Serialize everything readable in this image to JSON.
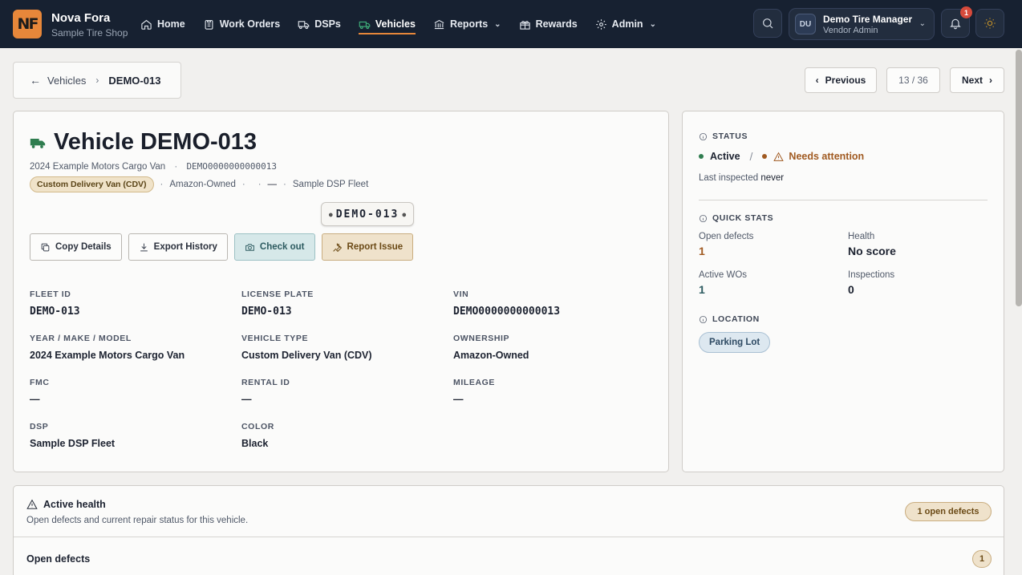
{
  "app": {
    "name": "Nova Fora",
    "shop": "Sample Tire Shop",
    "logo_text": "NF"
  },
  "nav": {
    "items": [
      {
        "label": "Home",
        "icon": "home-icon"
      },
      {
        "label": "Work Orders",
        "icon": "clipboard-icon"
      },
      {
        "label": "DSPs",
        "icon": "truck-icon"
      },
      {
        "label": "Vehicles",
        "icon": "van-icon",
        "active": true
      },
      {
        "label": "Reports",
        "icon": "bank-icon",
        "dropdown": true
      },
      {
        "label": "Rewards",
        "icon": "gift-icon"
      },
      {
        "label": "Admin",
        "icon": "gear-icon",
        "dropdown": true
      }
    ]
  },
  "user": {
    "initials": "DU",
    "name": "Demo Tire Manager",
    "role": "Vendor Admin",
    "notifications": "1"
  },
  "breadcrumb": {
    "parent": "Vehicles",
    "current": "DEMO-013"
  },
  "pager": {
    "previous": "Previous",
    "count": "13 / 36",
    "next": "Next"
  },
  "vehicle": {
    "title": "Vehicle DEMO-013",
    "model_line": "2024 Example Motors Cargo Van",
    "vin_line": "DEMO0000000000013",
    "type_pill": "Custom Delivery Van (CDV)",
    "ownership_tag": "Amazon-Owned",
    "dash": "—",
    "fleet_tag": "Sample DSP Fleet",
    "plate": "DEMO-013"
  },
  "actions": {
    "copy": "Copy Details",
    "export": "Export History",
    "checkout": "Check out",
    "report": "Report Issue"
  },
  "fields": [
    {
      "label": "FLEET ID",
      "value": "DEMO-013",
      "mono": true
    },
    {
      "label": "LICENSE PLATE",
      "value": "DEMO-013",
      "mono": true
    },
    {
      "label": "VIN",
      "value": "DEMO0000000000013",
      "mono": true
    },
    {
      "label": "YEAR / MAKE / MODEL",
      "value": "2024 Example Motors Cargo Van"
    },
    {
      "label": "VEHICLE TYPE",
      "value": "Custom Delivery Van (CDV)"
    },
    {
      "label": "OWNERSHIP",
      "value": "Amazon-Owned"
    },
    {
      "label": "FMC",
      "value": "—"
    },
    {
      "label": "RENTAL ID",
      "value": "—"
    },
    {
      "label": "MILEAGE",
      "value": "—"
    },
    {
      "label": "DSP",
      "value": "Sample DSP Fleet"
    },
    {
      "label": "COLOR",
      "value": "Black"
    }
  ],
  "status": {
    "label": "STATUS",
    "active": "Active",
    "attention": "Needs attention",
    "last_inspected_prefix": "Last inspected",
    "last_inspected_value": "never"
  },
  "quick_stats": {
    "label": "QUICK STATS",
    "open_defects_label": "Open defects",
    "open_defects_value": "1",
    "health_label": "Health",
    "health_value": "No score",
    "active_wos_label": "Active WOs",
    "active_wos_value": "1",
    "inspections_label": "Inspections",
    "inspections_value": "0"
  },
  "location": {
    "label": "LOCATION",
    "value": "Parking Lot"
  },
  "health": {
    "title": "Active health",
    "subtitle": "Open defects and current repair status for this vehicle.",
    "badge": "1 open defects",
    "open_defects_heading": "Open defects",
    "open_defects_count": "1"
  },
  "colors": {
    "accent": "#e7873a",
    "nav_bg": "#172131",
    "active_green": "#2f7d4f",
    "warning": "#a05a21",
    "teal": "#2d5b60"
  }
}
